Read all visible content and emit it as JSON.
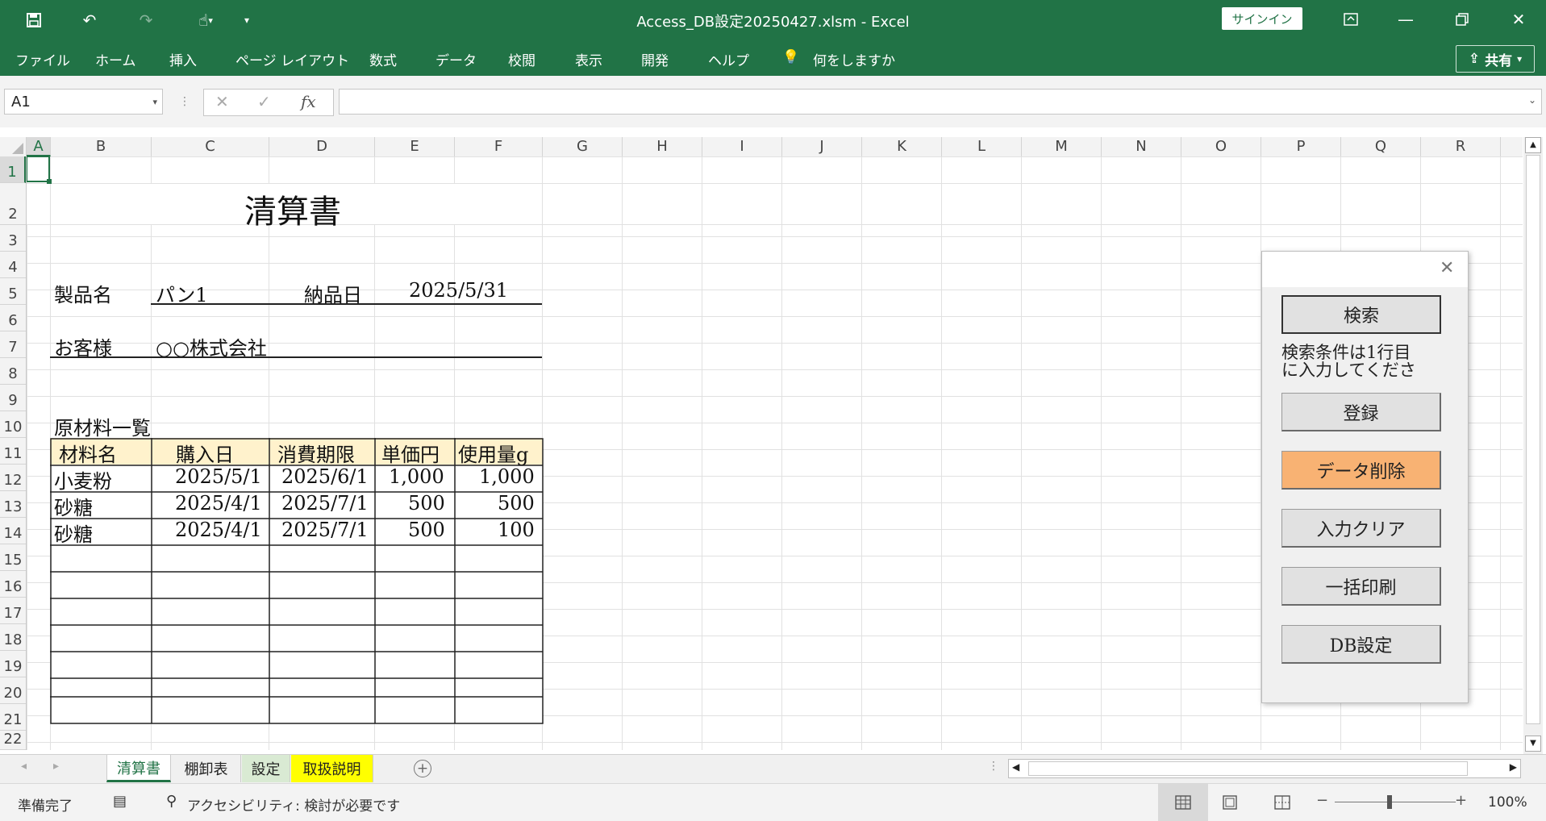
{
  "window": {
    "title": "Access_DB設定20250427.xlsm  -  Excel",
    "signin": "サインイン"
  },
  "ribbon": {
    "tabs": [
      "ファイル",
      "ホーム",
      "挿入",
      "ページ レイアウト",
      "数式",
      "データ",
      "校閲",
      "表示",
      "開発",
      "ヘルプ"
    ],
    "search": "何をしますか",
    "share": "共有"
  },
  "formula_bar": {
    "name_box": "A1",
    "cancel": "✕",
    "enter": "✓",
    "fx": "fx",
    "value": ""
  },
  "columns": [
    "A",
    "B",
    "C",
    "D",
    "E",
    "F",
    "G",
    "H",
    "I",
    "J",
    "K",
    "L",
    "M",
    "N",
    "O",
    "P",
    "Q",
    "R"
  ],
  "rows": [
    "1",
    "2",
    "3",
    "4",
    "5",
    "6",
    "7",
    "8",
    "9",
    "10",
    "11",
    "12",
    "13",
    "14",
    "15",
    "16",
    "17",
    "18",
    "19",
    "20",
    "21",
    "22"
  ],
  "sheet": {
    "doc_title": "清算書",
    "product_label": "製品名",
    "product_value": "パン1",
    "delivery_label": "納品日",
    "delivery_value": "2025/5/31",
    "customer_label": "お客様",
    "customer_value": "○○株式会社",
    "materials_title": "原材料一覧",
    "headers": [
      "材料名",
      "購入日",
      "消費期限",
      "単価円",
      "使用量g"
    ],
    "rows": [
      [
        "小麦粉",
        "2025/5/1",
        "2025/6/1",
        "1,000",
        "1,000"
      ],
      [
        "砂糖",
        "2025/4/1",
        "2025/7/1",
        "500",
        "500"
      ],
      [
        "砂糖",
        "2025/4/1",
        "2025/7/1",
        "500",
        "100"
      ]
    ]
  },
  "panel": {
    "search": "検索",
    "note_line1": "検索条件は1行目",
    "note_line2": "に入力してくださ",
    "register": "登録",
    "delete": "データ削除",
    "clear": "入力クリア",
    "print": "一括印刷",
    "db": "DB設定"
  },
  "sheet_tabs": [
    "清算書",
    "棚卸表",
    "設定",
    "取扱説明"
  ],
  "status": {
    "ready": "準備完了",
    "accessibility": "アクセシビリティ: 検討が必要です",
    "zoom": "100%"
  },
  "colors": {
    "excel_green": "#217346",
    "header_fill": "#fff2cc",
    "delete_button": "#f8b273",
    "tab_yellow": "#ffff00",
    "tab_green": "#d9ead3"
  }
}
